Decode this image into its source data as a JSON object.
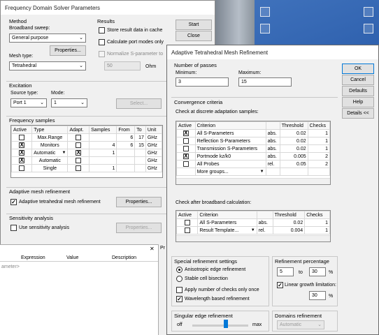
{
  "desktop": {
    "bg": "#2a5caa"
  },
  "fds": {
    "title": "Frequency Domain Solver Parameters",
    "method_label": "Method",
    "broadband_label": "Broadband sweep:",
    "broadband_value": "General purpose",
    "properties_label": "Properties...",
    "mesh_type_label": "Mesh type:",
    "mesh_type_value": "Tetrahedral",
    "results_label": "Results",
    "store_result": "Store result data in cache",
    "calc_port_modes": "Calculate port modes only",
    "normalize": "Normalize S-parameter to",
    "ohm_value": "50",
    "ohm_unit": "Ohm",
    "start": "Start",
    "close": "Close",
    "excitation_label": "Excitation",
    "source_type_label": "Source type:",
    "source_type_value": "Port 1",
    "mode_label": "Mode:",
    "mode_value": "1",
    "select_label": "Select...",
    "freq_samples_label": "Frequency samples",
    "columns": [
      "Active",
      "Type",
      "Adapt.",
      "Samples",
      "From",
      "To",
      "Unit"
    ],
    "rows": [
      {
        "active": "",
        "type": "Max.Range",
        "adapt": "",
        "samples": "",
        "from": "6",
        "to": "17",
        "unit": "GHz",
        "typedd": false
      },
      {
        "active": "X",
        "type": "Monitors",
        "adapt": "",
        "samples": "4",
        "from": "6",
        "to": "15",
        "unit": "GHz",
        "typedd": false
      },
      {
        "active": "X",
        "type": "Automatic",
        "adapt": "X",
        "samples": "1",
        "from": "",
        "to": "",
        "unit": "GHz",
        "typedd": true
      },
      {
        "active": "X",
        "type": "Automatic",
        "adapt": "",
        "samples": "",
        "from": "",
        "to": "",
        "unit": "GHz",
        "typedd": false
      },
      {
        "active": "",
        "type": "Single",
        "adapt": "",
        "samples": "1",
        "from": "",
        "to": "",
        "unit": "GHz",
        "typedd": false
      }
    ],
    "adaptive_label": "Adaptive mesh refinement",
    "adaptive_tet": "Adaptive tetrahedral mesh refinement",
    "sensitivity_label": "Sensitivity analysis",
    "use_sensitivity": "Use sensitivity analysis"
  },
  "param_panel": {
    "columns": [
      "Expression",
      "Value",
      "Description"
    ],
    "row_label": "ameter>",
    "side_tab": "Pr"
  },
  "amr": {
    "title": "Adaptive Tetrahedral Mesh Refinement",
    "num_passes_label": "Number of passes",
    "minimum_label": "Minimum:",
    "minimum_value": "3",
    "maximum_label": "Maximum:",
    "maximum_value": "15",
    "ok": "OK",
    "cancel": "Cancel",
    "defaults": "Defaults",
    "help": "Help",
    "details": "Details <<",
    "conv_label": "Convergence criteria",
    "discrete_label": "Check at discrete adaptation samples:",
    "columns": [
      "Active",
      "Criterion",
      "",
      "Threshold",
      "Checks"
    ],
    "crit_rows": [
      {
        "active": "X",
        "criterion": "All S-Parameters",
        "type": "abs.",
        "threshold": "0.02",
        "checks": "1"
      },
      {
        "active": "",
        "criterion": "Reflection S-Parameters",
        "type": "abs.",
        "threshold": "0.02",
        "checks": "1"
      },
      {
        "active": "",
        "criterion": "Transmission S-Parameters",
        "type": "abs.",
        "threshold": "0.02",
        "checks": "1"
      },
      {
        "active": "X",
        "criterion": "Portmode kz/k0",
        "type": "abs.",
        "threshold": "0.005",
        "checks": "2"
      },
      {
        "active": "",
        "criterion": "All Probes",
        "type": "rel.",
        "threshold": "0.05",
        "checks": "2"
      }
    ],
    "more_groups": "More groups...",
    "broadband_check_label": "Check after broadband calculation:",
    "bb_rows": [
      {
        "active": "",
        "criterion": "All S-Parameters",
        "type": "abs.",
        "threshold": "0.02",
        "checks": "1"
      },
      {
        "active": "",
        "criterion": "Result Template...",
        "type": "rel.",
        "threshold": "0.004",
        "checks": "1"
      }
    ],
    "special_label": "Special refinement settings",
    "aniso": "Anisotropic edge refinement",
    "stable": "Stable cell bisection",
    "apply_checks": "Apply number of checks only once",
    "wavelength": "Wavelength based refinement",
    "pct_label": "Refinement percentage",
    "pct_from": "5",
    "pct_to_label": "to",
    "pct_to": "30",
    "pct_unit": "%",
    "linear_growth": "Linear growth limitation:",
    "linear_value": "30",
    "linear_unit": "%",
    "singular_label": "Singular edge refinement",
    "off": "off",
    "max": "max",
    "domains_label": "Domains refinement",
    "domains_value": "Automatic"
  }
}
